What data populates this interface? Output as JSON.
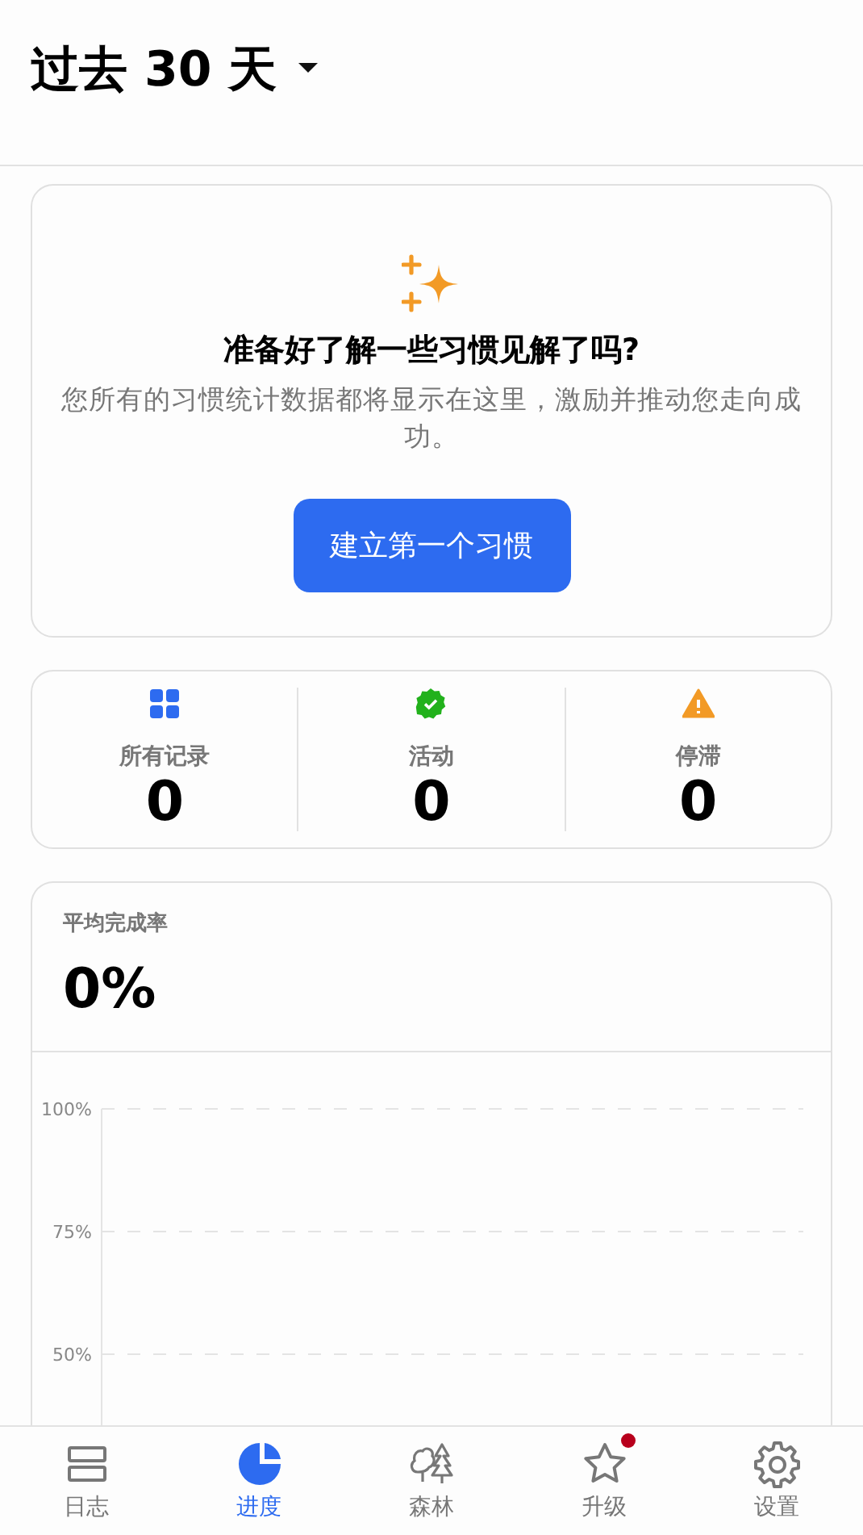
{
  "header": {
    "title": "过去 30 天",
    "dropdown": true
  },
  "intro": {
    "heading": "准备好了解一些习惯见解了吗?",
    "description": "您所有的习惯统计数据都将显示在这里，激励并推动您走向成功。",
    "button": "建立第一个习惯"
  },
  "stats": [
    {
      "kind": "grid",
      "label": "所有记录",
      "value": "0",
      "color": "#2d6bf0"
    },
    {
      "kind": "check",
      "label": "活动",
      "value": "0",
      "color": "#22b11c"
    },
    {
      "kind": "warning",
      "label": "停滞",
      "value": "0",
      "color": "#f29a26"
    }
  ],
  "completion": {
    "label": "平均完成率",
    "value": "0%",
    "axis_labels": [
      "100%",
      "75%",
      "50%"
    ]
  },
  "nav": [
    {
      "kind": "journal",
      "label": "日志",
      "selected": false,
      "badge": false
    },
    {
      "kind": "progress",
      "label": "进度",
      "selected": true,
      "badge": false
    },
    {
      "kind": "forest",
      "label": "森林",
      "selected": false,
      "badge": false
    },
    {
      "kind": "upgrade",
      "label": "升级",
      "selected": false,
      "badge": true
    },
    {
      "kind": "settings",
      "label": "设置",
      "selected": false,
      "badge": false
    }
  ]
}
